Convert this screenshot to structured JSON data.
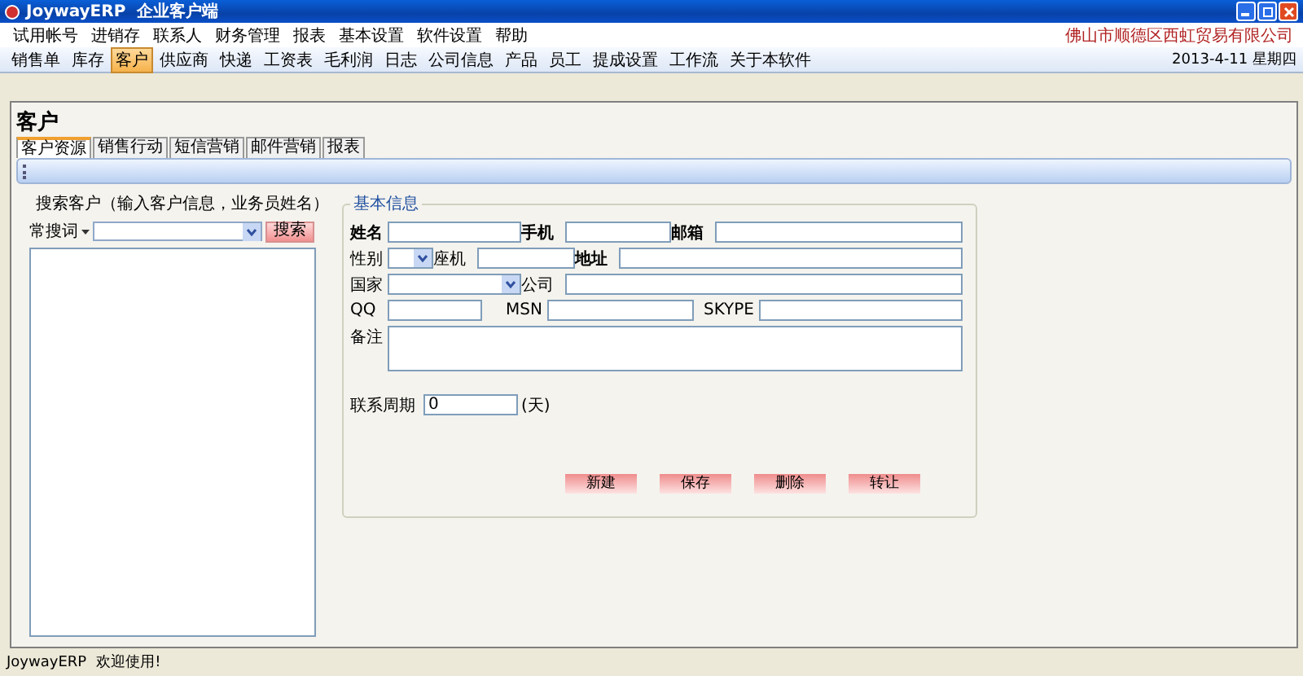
{
  "window": {
    "title": "JoywayERP  企业客户端"
  },
  "menu": [
    "试用帐号",
    "进销存",
    "联系人",
    "财务管理",
    "报表",
    "基本设置",
    "软件设置",
    "帮助"
  ],
  "company": "佛山市顺德区西虹贸易有限公司",
  "toolbar": [
    {
      "label": "销售单",
      "selected": false
    },
    {
      "label": "库存",
      "selected": false
    },
    {
      "label": "客户",
      "selected": true
    },
    {
      "label": "供应商",
      "selected": false
    },
    {
      "label": "快递",
      "selected": false
    },
    {
      "label": "工资表",
      "selected": false
    },
    {
      "label": "毛利润",
      "selected": false
    },
    {
      "label": "日志",
      "selected": false
    },
    {
      "label": "公司信息",
      "selected": false
    },
    {
      "label": "产品",
      "selected": false
    },
    {
      "label": "员工",
      "selected": false
    },
    {
      "label": "提成设置",
      "selected": false
    },
    {
      "label": "工作流",
      "selected": false
    },
    {
      "label": "关于本软件",
      "selected": false
    }
  ],
  "date": "2013-4-11  星期四",
  "page_title": "客户",
  "tabs": [
    {
      "label": "客户资源",
      "selected": true
    },
    {
      "label": "销售行动",
      "selected": false
    },
    {
      "label": "短信营销",
      "selected": false
    },
    {
      "label": "邮件营销",
      "selected": false
    },
    {
      "label": "报表",
      "selected": false
    }
  ],
  "search": {
    "label": "搜索客户（输入客户信息，业务员姓名）",
    "keyword_menu": "常搜词",
    "button": "搜索"
  },
  "group": {
    "title": "基本信息",
    "rows": [
      [
        {
          "label": "姓名",
          "bold": true,
          "kind": "text"
        },
        {
          "label": "手机",
          "bold": true,
          "kind": "text"
        },
        {
          "label": "邮箱",
          "bold": true,
          "kind": "text"
        }
      ],
      [
        {
          "label": "性别",
          "bold": false,
          "kind": "select"
        },
        {
          "label": "座机",
          "bold": false,
          "kind": "text"
        },
        {
          "label": "地址",
          "bold": true,
          "kind": "text"
        }
      ],
      [
        {
          "label": "国家",
          "bold": false,
          "kind": "select"
        },
        {
          "label": "公司",
          "bold": false,
          "kind": "text"
        }
      ],
      [
        {
          "label": "QQ",
          "bold": false,
          "kind": "text"
        },
        {
          "label": "MSN",
          "bold": false,
          "kind": "text"
        },
        {
          "label": "SKYPE",
          "bold": false,
          "kind": "text"
        }
      ],
      [
        {
          "label": "备注",
          "bold": false,
          "kind": "textarea"
        }
      ]
    ],
    "period": {
      "label": "联系周期",
      "value": "0",
      "unit": "(天)"
    },
    "buttons": [
      "新建",
      "保存",
      "删除",
      "转让"
    ]
  },
  "status_bar": {
    "app": "JoywayERP",
    "message": "欢迎使用!"
  }
}
